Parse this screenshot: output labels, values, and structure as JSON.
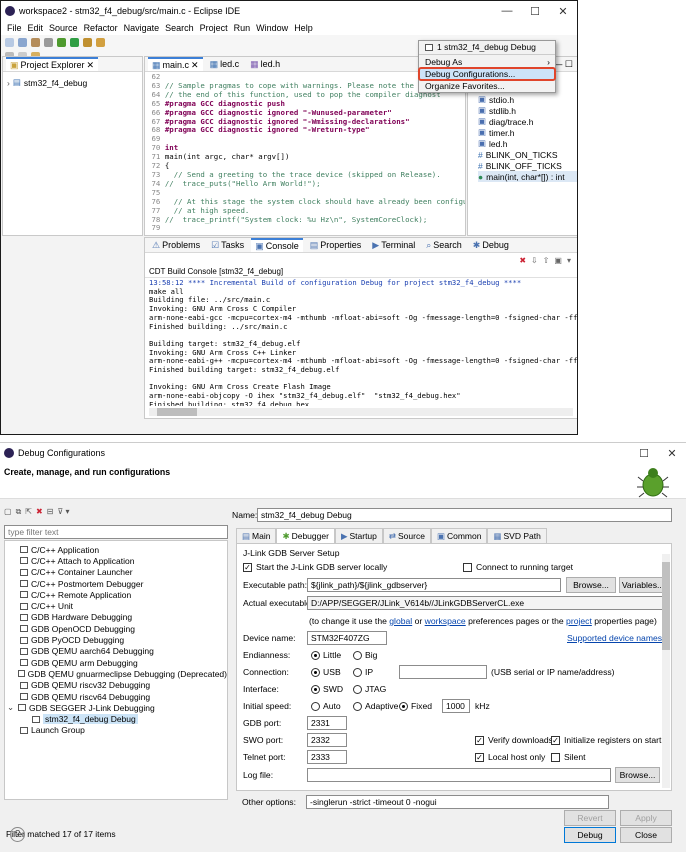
{
  "eclipse": {
    "title": "workspace2 - stm32_f4_debug/src/main.c - Eclipse IDE",
    "menu": [
      "File",
      "Edit",
      "Source",
      "Refactor",
      "Navigate",
      "Search",
      "Project",
      "Run",
      "Window",
      "Help"
    ],
    "project_explorer": {
      "title": "Project Explorer",
      "project": "stm32_f4_debug"
    },
    "editor_tabs": [
      "main.c",
      "led.c",
      "led.h"
    ],
    "code": [
      {
        "n": "62",
        "t": ""
      },
      {
        "n": "63",
        "t": "// Sample pragmas to cope with warnings. Please note the relat"
      },
      {
        "n": "64",
        "t": "// the end of this function, used to pop the compiler diagnost"
      },
      {
        "n": "65",
        "t": "#pragma GCC diagnostic push"
      },
      {
        "n": "66",
        "t": "#pragma GCC diagnostic ignored \"-Wunused-parameter\""
      },
      {
        "n": "67",
        "t": "#pragma GCC diagnostic ignored \"-Wmissing-declarations\""
      },
      {
        "n": "68",
        "t": "#pragma GCC diagnostic ignored \"-Wreturn-type\""
      },
      {
        "n": "69",
        "t": ""
      },
      {
        "n": "70",
        "t": "int"
      },
      {
        "n": "71",
        "t": "main(int argc, char* argv[])"
      },
      {
        "n": "72",
        "t": "{"
      },
      {
        "n": "73",
        "t": "  // Send a greeting to the trace device (skipped on Release)."
      },
      {
        "n": "74",
        "t": "//  trace_puts(\"Hello Arm World!\");"
      },
      {
        "n": "75",
        "t": ""
      },
      {
        "n": "76",
        "t": "  // At this stage the system clock should have already been configur"
      },
      {
        "n": "77",
        "t": "  // at high speed."
      },
      {
        "n": "78",
        "t": "//  trace_printf(\"System clock: %u Hz\\n\", SystemCoreClock);"
      },
      {
        "n": "79",
        "t": ""
      }
    ],
    "outline": [
      "stdio.h",
      "stdlib.h",
      "diag/trace.h",
      "timer.h",
      "led.h",
      "BLINK_ON_TICKS",
      "BLINK_OFF_TICKS",
      "main(int, char*[]) : int"
    ],
    "dropdown": {
      "item1": "1 stm32_f4_debug Debug",
      "item2": "Debug As",
      "item3": "Debug Configurations...",
      "item4": "Organize Favorites..."
    },
    "bottom_tabs": [
      "Problems",
      "Tasks",
      "Console",
      "Properties",
      "Terminal",
      "Search",
      "Debug"
    ],
    "console_title": "CDT Build Console [stm32_f4_debug]",
    "console": [
      "13:58:12 **** Incremental Build of configuration Debug for project stm32_f4_debug ****",
      "make all",
      "Building file: ../src/main.c",
      "Invoking: GNU Arm Cross C Compiler",
      "arm-none-eabi-gcc -mcpu=cortex-m4 -mthumb -mfloat-abi=soft -Og -fmessage-length=0 -fsigned-char -ffunctic",
      "Finished building: ../src/main.c",
      "",
      "Building target: stm32_f4_debug.elf",
      "Invoking: GNU Arm Cross C++ Linker",
      "arm-none-eabi-g++ -mcpu=cortex-m4 -mthumb -mfloat-abi=soft -Og -fmessage-length=0 -fsigned-char -ffunctic",
      "Finished building target: stm32_f4_debug.elf",
      "",
      "Invoking: GNU Arm Cross Create Flash Image",
      "arm-none-eabi-objcopy -O ihex \"stm32_f4_debug.elf\"  \"stm32_f4_debug.hex\"",
      "Finished building: stm32_f4_debug.hex"
    ]
  },
  "dialog": {
    "title": "Debug Configurations",
    "subtitle": "Create, manage, and run configurations",
    "filter_placeholder": "type filter text",
    "tree": [
      {
        "label": "C/C++ Application",
        "indent": 0
      },
      {
        "label": "C/C++ Attach to Application",
        "indent": 0
      },
      {
        "label": "C/C++ Container Launcher",
        "indent": 0
      },
      {
        "label": "C/C++ Postmortem Debugger",
        "indent": 0
      },
      {
        "label": "C/C++ Remote Application",
        "indent": 0
      },
      {
        "label": "C/C++ Unit",
        "indent": 0
      },
      {
        "label": "GDB Hardware Debugging",
        "indent": 0
      },
      {
        "label": "GDB OpenOCD Debugging",
        "indent": 0
      },
      {
        "label": "GDB PyOCD Debugging",
        "indent": 0
      },
      {
        "label": "GDB QEMU aarch64 Debugging",
        "indent": 0
      },
      {
        "label": "GDB QEMU arm Debugging",
        "indent": 0
      },
      {
        "label": "GDB QEMU gnuarmeclipse Debugging (Deprecated)",
        "indent": 0
      },
      {
        "label": "GDB QEMU riscv32 Debugging",
        "indent": 0
      },
      {
        "label": "GDB QEMU riscv64 Debugging",
        "indent": 0
      },
      {
        "label": "GDB SEGGER J-Link Debugging",
        "indent": 0
      },
      {
        "label": "stm32_f4_debug Debug",
        "indent": 1
      },
      {
        "label": "Launch Group",
        "indent": 0
      }
    ],
    "filter_status": "Filter matched 17 of 17 items",
    "name_label": "Name:",
    "name_value": "stm32_f4_debug Debug",
    "tabs": [
      "Main",
      "Debugger",
      "Startup",
      "Source",
      "Common",
      "SVD Path"
    ],
    "section": "J-Link GDB Server Setup",
    "start_server": "Start the J-Link GDB server locally",
    "connect_running": "Connect to running target",
    "exec_label": "Executable path:",
    "exec_value": "${jlink_path}/${jlink_gdbserver}",
    "browse": "Browse...",
    "variables": "Variables...",
    "actual_label": "Actual executable:",
    "actual_value": "D:/APP/SEGGER/JLink_V614b//JLinkGDBServerCL.exe",
    "change_pre": "(to change it use the",
    "global": "global",
    "or": "or",
    "workspace": "workspace",
    "pref_mid": "preferences pages or the",
    "project": "project",
    "pref_end": "properties page)",
    "device_label": "Device name:",
    "device_value": "STM32F407ZG",
    "supported": "Supported device names",
    "endian_label": "Endianness:",
    "little": "Little",
    "big": "Big",
    "conn_label": "Connection:",
    "usb": "USB",
    "ip": "IP",
    "conn_hint": "(USB serial or IP name/address)",
    "iface_label": "Interface:",
    "swd": "SWD",
    "jtag": "JTAG",
    "speed_label": "Initial speed:",
    "auto": "Auto",
    "adaptive": "Adaptive",
    "fixed": "Fixed",
    "speed_value": "1000",
    "khz": "kHz",
    "gdbport_label": "GDB port:",
    "gdbport": "2331",
    "swoport_label": "SWO port:",
    "swoport": "2332",
    "verify": "Verify downloads",
    "init_regs": "Initialize registers on start",
    "telnet_label": "Telnet port:",
    "telnet": "2333",
    "localhost": "Local host only",
    "silent": "Silent",
    "log_label": "Log file:",
    "other_label": "Other options:",
    "other_value": "-singlerun -strict -timeout 0 -nogui",
    "revert": "Revert",
    "apply": "Apply",
    "debug": "Debug",
    "close": "Close"
  }
}
